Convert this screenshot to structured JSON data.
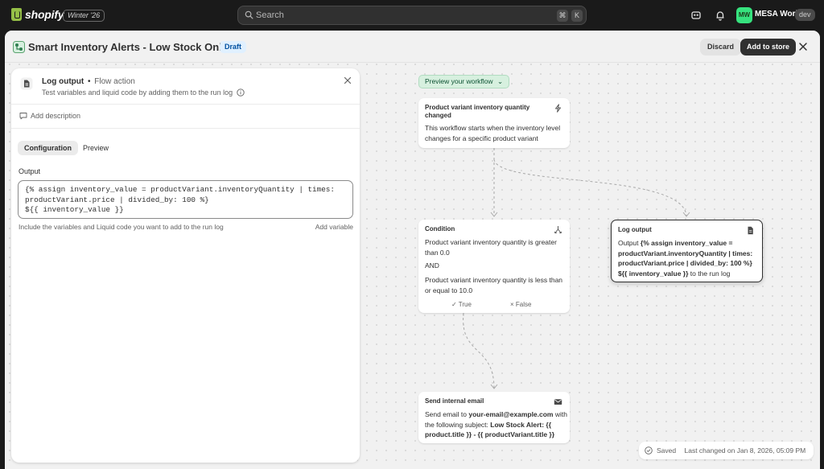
{
  "topbar": {
    "brand": "shopify",
    "edition": "Winter '26",
    "search_placeholder": "Search",
    "shortcut_keys": [
      "⌘",
      "K"
    ],
    "avatar_initials": "MW",
    "store_name": "MESA World",
    "store_badge": "dev"
  },
  "header": {
    "title": "Smart Inventory Alerts - Low Stock Only",
    "status": "Draft",
    "discard_label": "Discard",
    "add_label": "Add to store"
  },
  "side_panel": {
    "title": "Log output",
    "separator": "•",
    "type": "Flow action",
    "subtitle": "Test variables and liquid code by adding them to the run log",
    "add_description": "Add description",
    "tabs": [
      {
        "label": "Configuration",
        "active": true
      },
      {
        "label": "Preview",
        "active": false
      }
    ],
    "output_label": "Output",
    "output_code": "{% assign inventory_value = productVariant.inventoryQuantity | times:\nproductVariant.price | divided_by: 100 %}\n${{ inventory_value }}",
    "help_text": "Include the variables and Liquid code you want to add to the run log",
    "add_variable": "Add variable"
  },
  "canvas": {
    "preview_button": "Preview your workflow",
    "trigger": {
      "title": "Product variant inventory quantity changed",
      "body": "This workflow starts when the inventory level changes for a specific product variant"
    },
    "condition": {
      "title": "Condition",
      "line1": "Product variant inventory quantity is greater than 0.0",
      "joiner": "AND",
      "line2": "Product variant inventory quantity is less than or equal to 10.0",
      "true_label": "True",
      "false_label": "False"
    },
    "log_node": {
      "title": "Log output",
      "prefix": "Output",
      "code": "{% assign inventory_value = productVariant.inventoryQuantity | times: productVariant.price | divided_by: 100 %} ${{ inventory_value }}",
      "suffix": "to the run log"
    },
    "email_node": {
      "title": "Send internal email",
      "pre": "Send email to",
      "address": "your-email@example.com",
      "mid": "with the following subject:",
      "subject": "Low Stock Alert: {{ product.title }} - {{ productVariant.title }}"
    },
    "saved_status": "Saved",
    "last_changed": "Last changed on Jan 8, 2026, 05:09 PM"
  },
  "colors": {
    "accent_green": "#36e27e",
    "draft_blue": "#e0f0ff",
    "preview_green": "#d7f0df"
  }
}
